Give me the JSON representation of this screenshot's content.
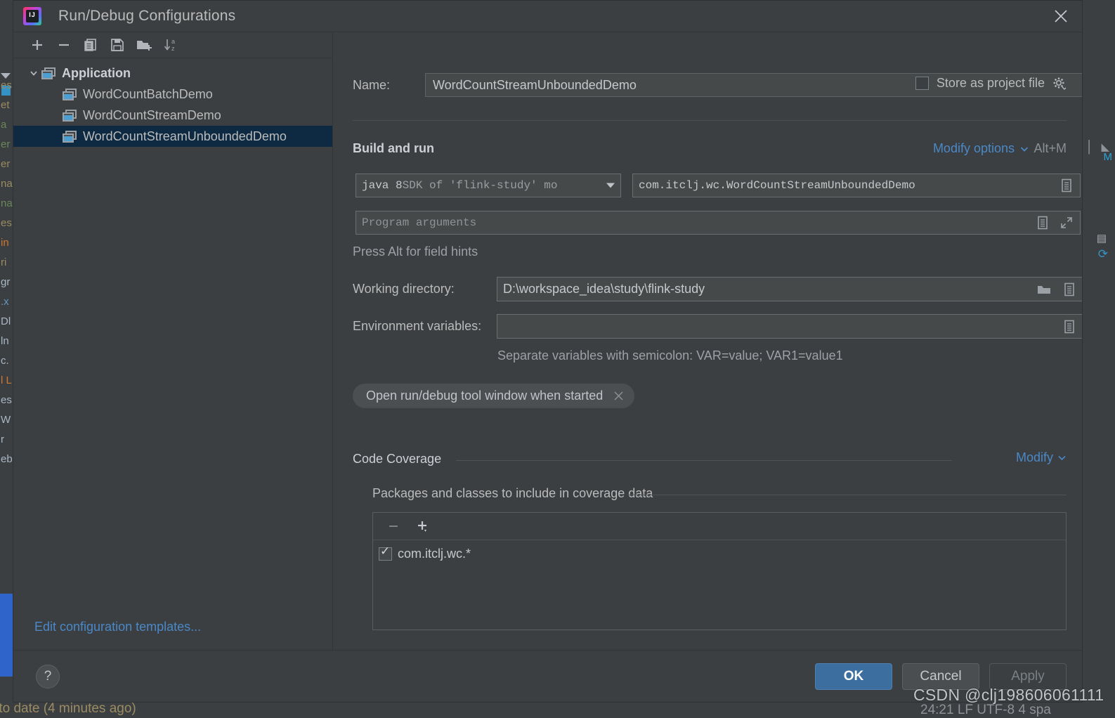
{
  "window": {
    "title": "Run/Debug Configurations",
    "app_icon": "intellij-idea-logo",
    "close_icon": "close-icon"
  },
  "left_pane": {
    "toolbar": [
      {
        "name": "add-configuration-button",
        "icon": "plus-icon",
        "label": "+"
      },
      {
        "name": "remove-configuration-button",
        "icon": "minus-icon",
        "label": "−"
      },
      {
        "name": "copy-configuration-button",
        "icon": "copy-icon",
        "label": "copy"
      },
      {
        "name": "save-configuration-button",
        "icon": "save-icon",
        "label": "save"
      },
      {
        "name": "new-folder-button",
        "icon": "folder-add-icon",
        "label": "new folder"
      },
      {
        "name": "sort-configurations-button",
        "icon": "sort-az-icon",
        "label": "sort a-z"
      }
    ],
    "tree": {
      "group_label": "Application",
      "items": [
        {
          "label": "WordCountBatchDemo",
          "selected": false
        },
        {
          "label": "WordCountStreamDemo",
          "selected": false
        },
        {
          "label": "WordCountStreamUnboundedDemo",
          "selected": true
        }
      ]
    },
    "edit_templates_link": "Edit configuration templates..."
  },
  "main": {
    "name_label": "Name:",
    "name_value": "WordCountStreamUnboundedDemo",
    "store_as_project_file_label": "Store as project file",
    "store_as_project_file_checked": false,
    "store_gear_icon": "gear-icon",
    "build_and_run_title": "Build and run",
    "modify_options_label": "Modify options",
    "modify_options_shortcut": "Alt+M",
    "sdk_value_bold": "java 8",
    "sdk_value_rest": " SDK of 'flink-study' mo",
    "main_class_value": "com.itclj.wc.WordCountStreamUnboundedDemo",
    "program_arguments_placeholder": "Program arguments",
    "press_alt_hint": "Press Alt for field hints",
    "working_directory_label": "Working directory:",
    "working_directory_value": "D:\\workspace_idea\\study\\flink-study",
    "environment_variables_label": "Environment variables:",
    "environment_variables_value": "",
    "environment_hint": "Separate variables with semicolon: VAR=value; VAR1=value1",
    "chip_label": "Open run/debug tool window when started",
    "chip_close_icon": "close-icon",
    "coverage": {
      "section_title": "Code Coverage",
      "modify_label": "Modify",
      "packages_title": "Packages and classes to include in coverage data",
      "remove_icon": "minus-icon",
      "add_icon": "plus-dropdown-icon",
      "items": [
        {
          "label": "com.itclj.wc.*",
          "checked": true
        }
      ]
    }
  },
  "footer": {
    "help_label": "?",
    "ok_label": "OK",
    "cancel_label": "Cancel",
    "apply_label": "Apply"
  },
  "annotations": {
    "highlight_box_color": "#fe0000",
    "highlight_target": "modify-options-link"
  },
  "watermark": {
    "text": "CSDN @clj198606061111"
  },
  "background": {
    "bottom_status_left": "-to date (4 minutes ago)",
    "bottom_status_right": "24:21  LF  UTF-8  4 spa",
    "editor_fragment": [
      "es",
      "et",
      "a",
      "er",
      "er",
      "na",
      "na",
      "es",
      "in",
      "ri",
      "gr",
      ".x",
      "Dl",
      "ln",
      "c.",
      "l L",
      "es",
      "W",
      "r",
      "",
      "eb"
    ]
  },
  "colors": {
    "dialog_bg": "#3c3f41",
    "field_bg": "#45494a",
    "accent_link": "#4a88c7",
    "selection": "#0d2a42",
    "primary_button": "#3c6e9f",
    "highlight": "#fe0000"
  }
}
